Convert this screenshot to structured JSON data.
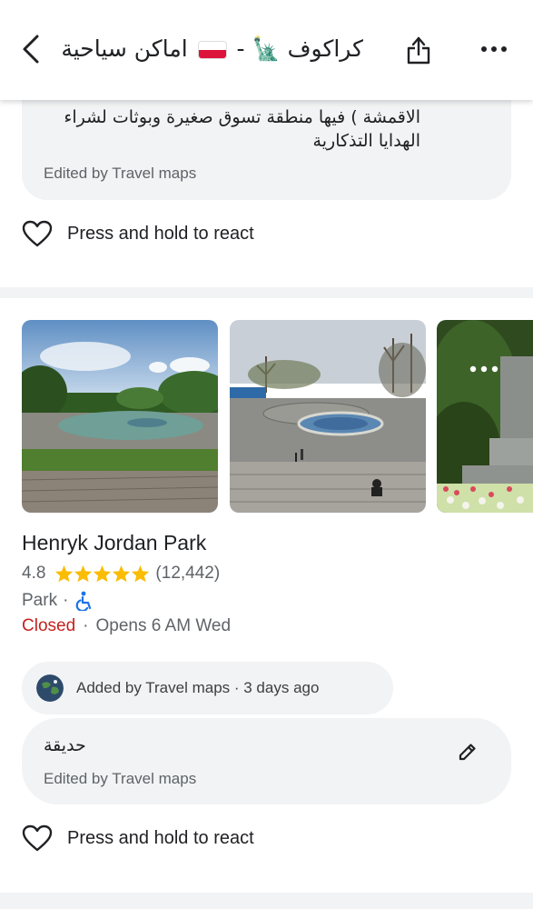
{
  "header": {
    "title": "كراكوف 🗽 - اماكن سياحية 🇵🇱",
    "title_left": "كراكوف",
    "title_right": "اماكن سياحية"
  },
  "first_place": {
    "note_lines": [
      "الاقمشة ) فيها منطقة تسوق صغيرة وبوثات لشراء",
      "الهدايا التذكارية"
    ],
    "edited_by": "Edited by Travel maps",
    "react_label": "Press and hold to react"
  },
  "place": {
    "name": "Henryk Jordan Park",
    "rating": "4.8",
    "stars": 5,
    "review_count": "(12,442)",
    "type": "Park",
    "type_separator": "·",
    "status": "Closed",
    "status_separator": "·",
    "opens": "Opens 6 AM Wed",
    "added_by": "Added by Travel maps · 3 days ago",
    "note": "حديقة",
    "edited_by": "Edited by Travel maps",
    "react_label": "Press and hold to react"
  },
  "colors": {
    "star": "#fbbc04",
    "closed": "#c5221f",
    "accessible": "#1a73e8",
    "card_bg": "#f1f3f4"
  },
  "icons": [
    "back-icon",
    "share-icon",
    "more-icon",
    "heart-icon",
    "star-icon",
    "wheelchair-icon",
    "edit-icon"
  ]
}
